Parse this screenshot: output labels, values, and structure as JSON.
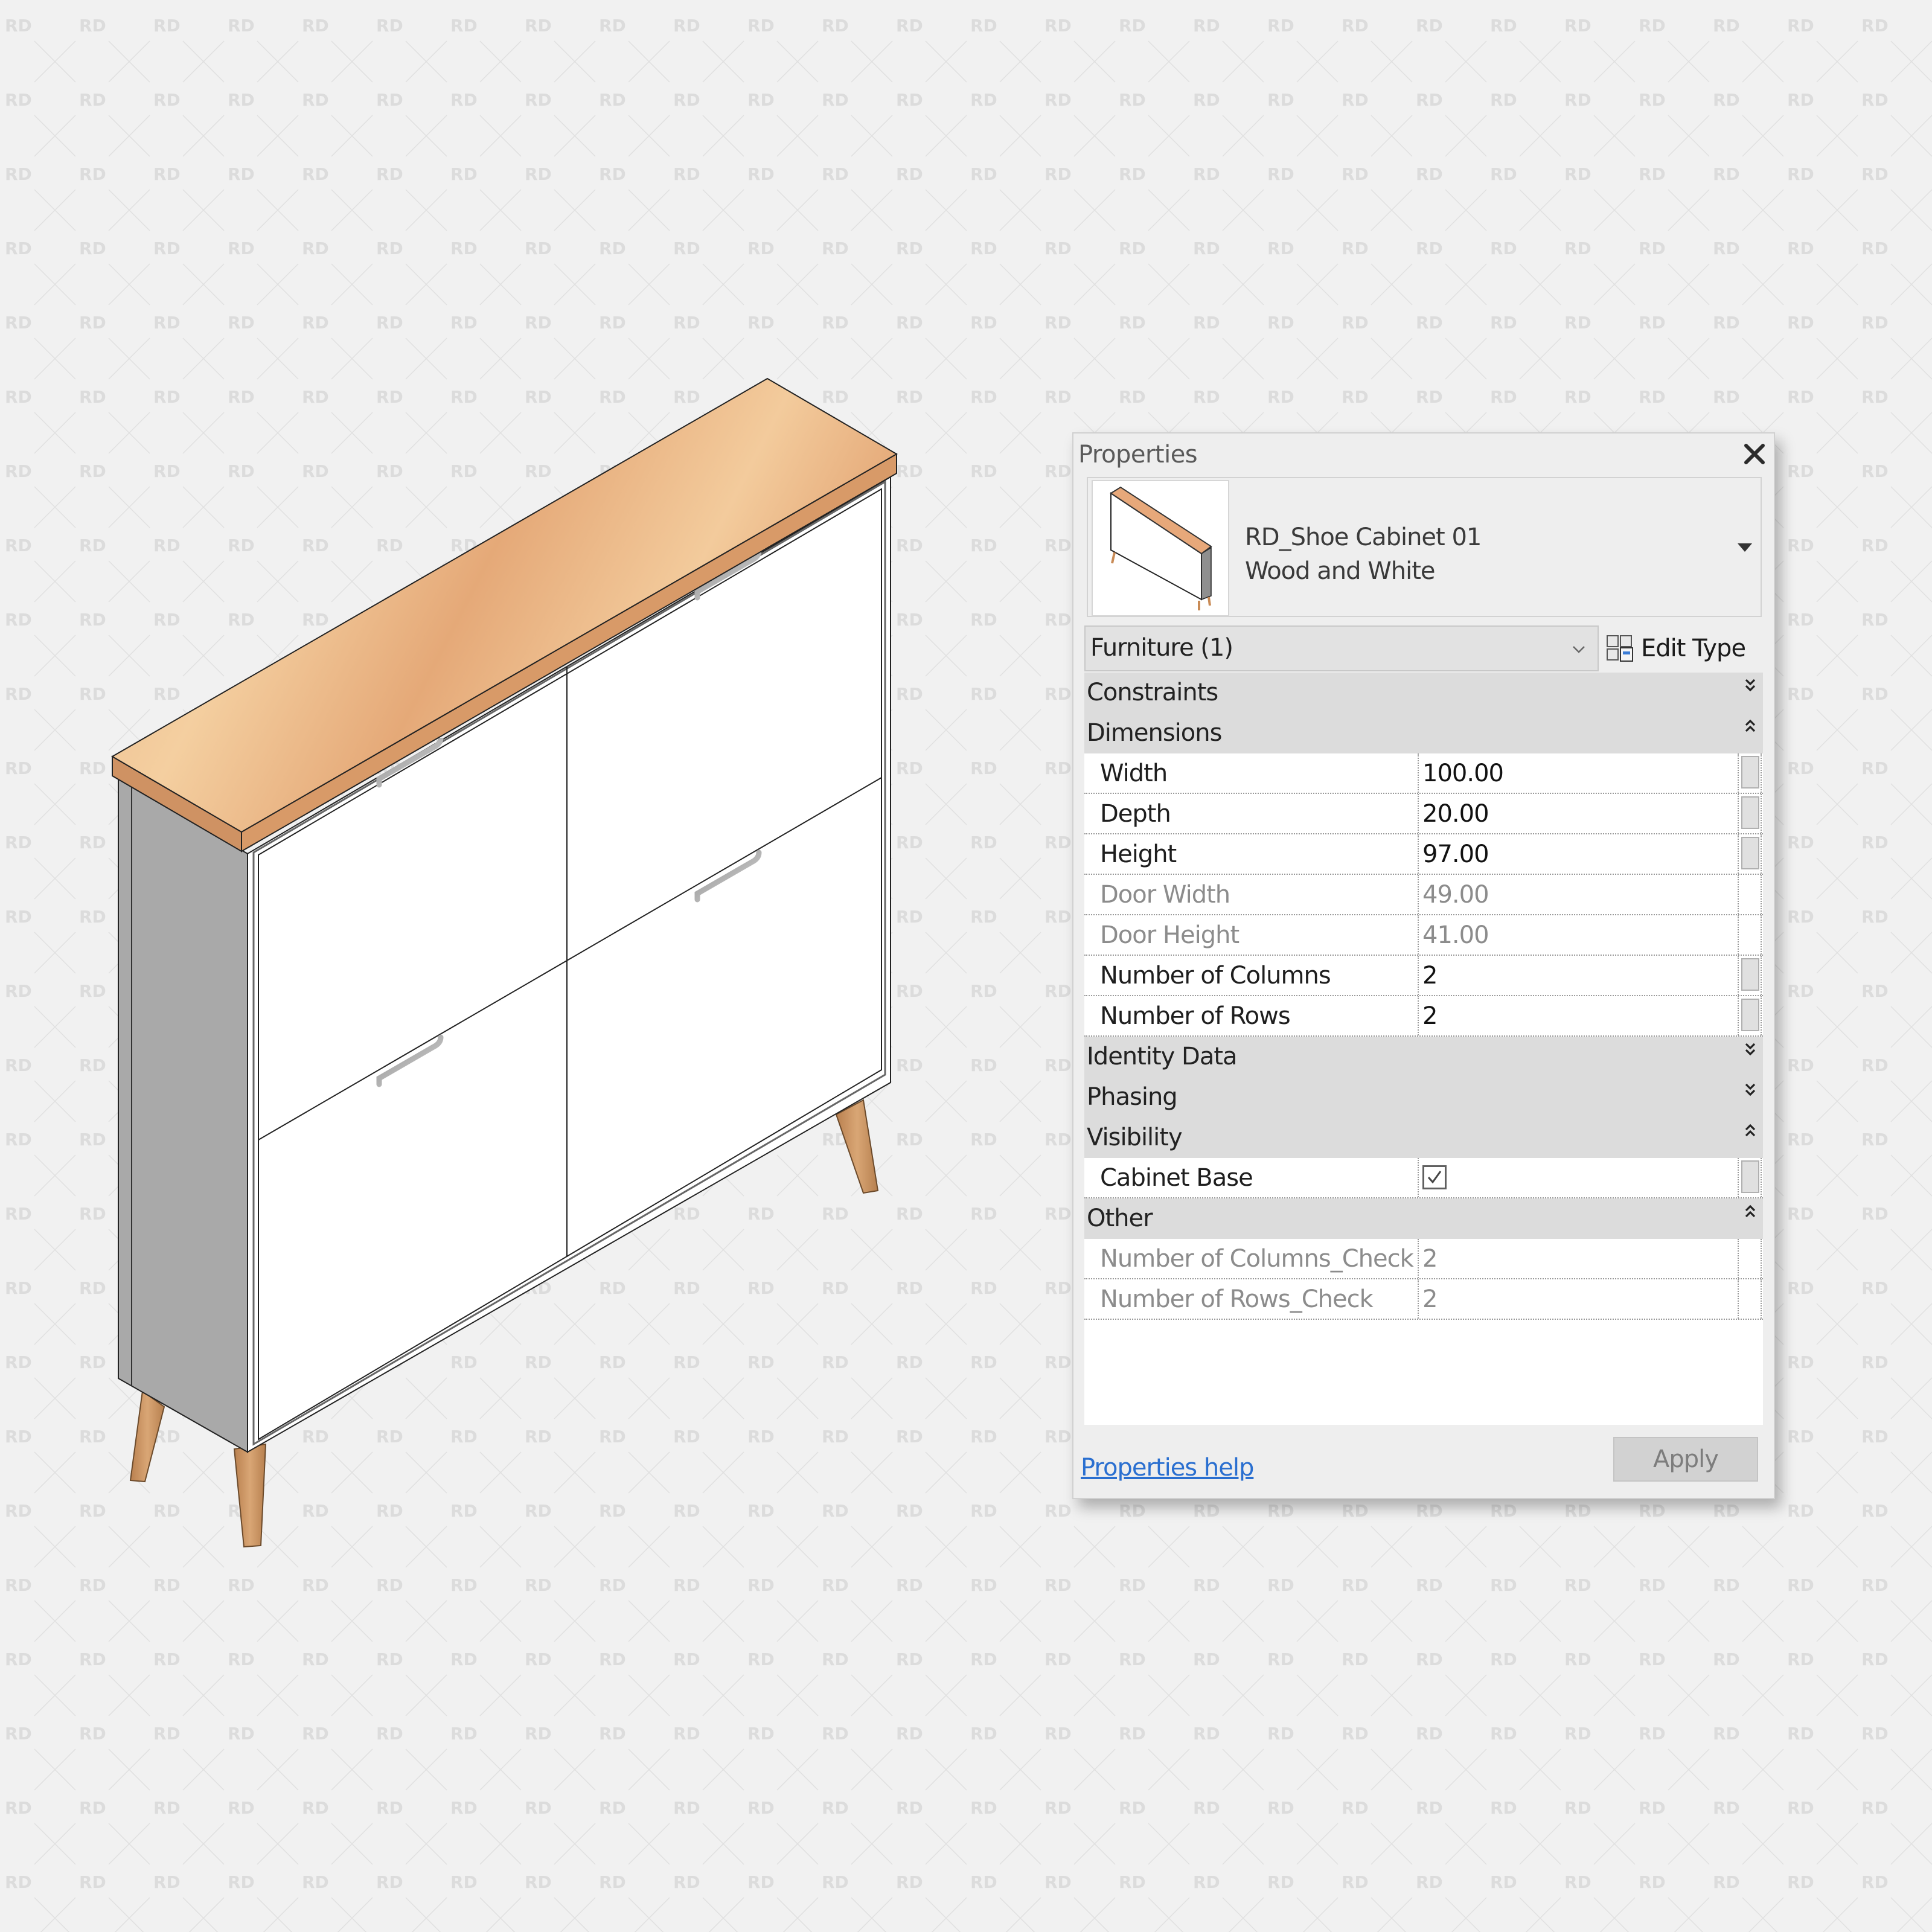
{
  "watermark": "RD",
  "colors": {
    "background": "#f1f1f1",
    "watermark": "#dcdcdc",
    "wood": "#e7b384",
    "wood_dark": "#c98b56",
    "cabinet_side": "#a9a9a9",
    "cabinet_front": "#ffffff",
    "link": "#2a6fd0"
  },
  "properties": {
    "title": "Properties",
    "close_icon": "close-icon",
    "type_selector": {
      "family": "RD_Shoe Cabinet 01",
      "type": "Wood and White"
    },
    "filter": {
      "selected": "Furniture (1)"
    },
    "edit_type_label": "Edit Type",
    "groups": [
      {
        "label": "Constraints",
        "expanded": false,
        "rows": []
      },
      {
        "label": "Dimensions",
        "expanded": true,
        "rows": [
          {
            "name": "Width",
            "value": "100.00",
            "editable": true,
            "assoc": true
          },
          {
            "name": "Depth",
            "value": "20.00",
            "editable": true,
            "assoc": true
          },
          {
            "name": "Height",
            "value": "97.00",
            "editable": true,
            "assoc": true
          },
          {
            "name": "Door Width",
            "value": "49.00",
            "editable": false,
            "assoc": false
          },
          {
            "name": "Door Height",
            "value": "41.00",
            "editable": false,
            "assoc": false
          },
          {
            "name": "Number of Columns",
            "value": "2",
            "editable": true,
            "assoc": true
          },
          {
            "name": "Number of Rows",
            "value": "2",
            "editable": true,
            "assoc": true
          }
        ]
      },
      {
        "label": "Identity Data",
        "expanded": false,
        "rows": []
      },
      {
        "label": "Phasing",
        "expanded": false,
        "rows": []
      },
      {
        "label": "Visibility",
        "expanded": true,
        "rows": [
          {
            "name": "Cabinet Base",
            "checked": true,
            "editable": true,
            "assoc": true
          }
        ]
      },
      {
        "label": "Other",
        "expanded": true,
        "rows": [
          {
            "name": "Number of Columns_Check",
            "value": "2",
            "editable": false,
            "assoc": false
          },
          {
            "name": "Number of Rows_Check",
            "value": "2",
            "editable": false,
            "assoc": false
          }
        ]
      }
    ],
    "help_link": "Properties help",
    "apply_label": "Apply"
  }
}
